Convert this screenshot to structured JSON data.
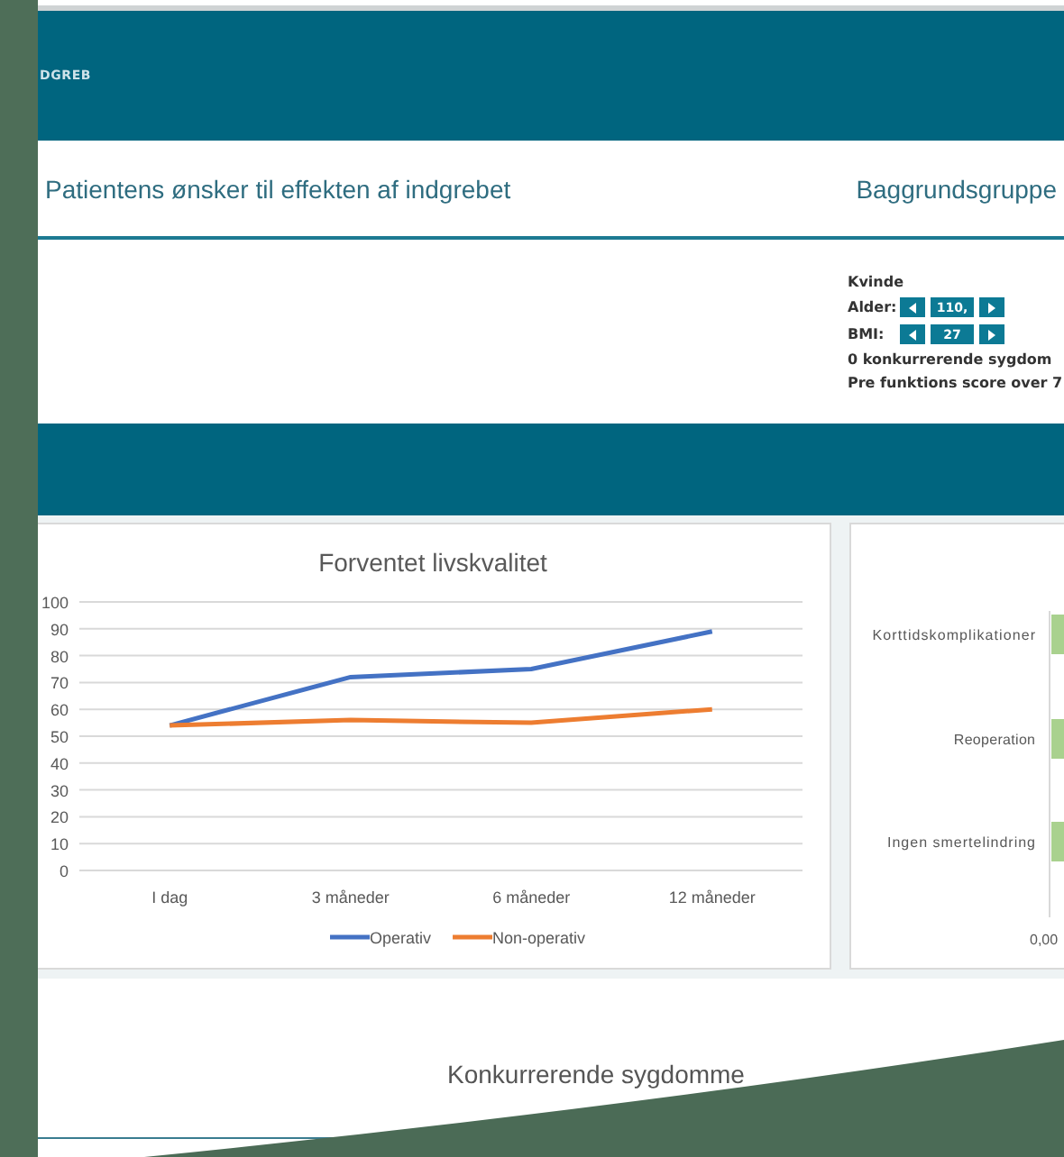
{
  "header": {
    "title": "DGREB"
  },
  "wishes_panel": {
    "title": "Patientens ønsker til effekten af indgrebet"
  },
  "background_group": {
    "title": "Baggrundsgruppe",
    "items": [
      {
        "kind": "text",
        "text": "Kvinde"
      },
      {
        "kind": "stepper",
        "label": "Alder:",
        "value": "110,"
      },
      {
        "kind": "stepper",
        "label": "BMI:",
        "value": "27"
      },
      {
        "kind": "text",
        "text": "0 konkurrerende sygdom"
      },
      {
        "kind": "text",
        "text": "Pre funktions score over 7"
      }
    ]
  },
  "quality_chart": {
    "chart_data": {
      "type": "line",
      "title": "Forventet livskvalitet",
      "categories": [
        "I dag",
        "3 måneder",
        "6 måneder",
        "12 måneder"
      ],
      "ylim": [
        0,
        100
      ],
      "yticks": [
        0,
        10,
        20,
        30,
        40,
        50,
        60,
        70,
        80,
        90,
        100
      ],
      "grid": true,
      "legend": true,
      "series": [
        {
          "name": "Operativ",
          "color": "#4472c4",
          "values": [
            54,
            72,
            75,
            89
          ]
        },
        {
          "name": "Non-operativ",
          "color": "#ed7d31",
          "values": [
            54,
            56,
            55,
            60
          ]
        }
      ]
    }
  },
  "risk_chart": {
    "categories": [
      "Korttidskomplikationer",
      "Reoperation",
      "Ingen smertelindring"
    ],
    "tick": "0,00"
  },
  "comorbidity": {
    "title": "Konkurrerende sygdomme"
  }
}
